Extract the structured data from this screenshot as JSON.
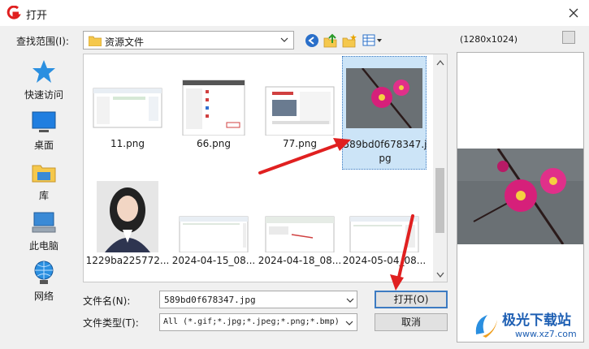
{
  "window": {
    "title": "打开"
  },
  "lookin": {
    "label": "查找范围(I):",
    "value": "资源文件"
  },
  "places": [
    {
      "label": "快速访问",
      "icon": "star-icon"
    },
    {
      "label": "桌面",
      "icon": "desktop-icon"
    },
    {
      "label": "库",
      "icon": "library-icon"
    },
    {
      "label": "此电脑",
      "icon": "computer-icon"
    },
    {
      "label": "网络",
      "icon": "network-icon"
    }
  ],
  "files": [
    {
      "name": "11.png",
      "selected": false
    },
    {
      "name": "66.png",
      "selected": false
    },
    {
      "name": "77.png",
      "selected": false
    },
    {
      "name": "589bd0f678347.jpg",
      "selected": true
    },
    {
      "name": "1229ba225772...",
      "selected": false
    },
    {
      "name": "2024-04-15_08...",
      "selected": false
    },
    {
      "name": "2024-04-18_08...",
      "selected": false
    },
    {
      "name": "2024-05-04_08...",
      "selected": false
    }
  ],
  "preview": {
    "size_text": "(1280x1024)"
  },
  "filename": {
    "label": "文件名(N):",
    "value": "589bd0f678347.jpg"
  },
  "filetype": {
    "label": "文件类型(T):",
    "value": "All (*.gif;*.jpg;*.jpeg;*.png;*.bmp)"
  },
  "buttons": {
    "open": "打开(O)",
    "cancel": "取消"
  },
  "watermark": {
    "title": "极光下载站",
    "url": "www.xz7.com"
  },
  "colors": {
    "accent": "#3d7bc2",
    "selection": "#cce4f7",
    "annotation": "#e02020",
    "watermark": "#1e5fb3"
  }
}
